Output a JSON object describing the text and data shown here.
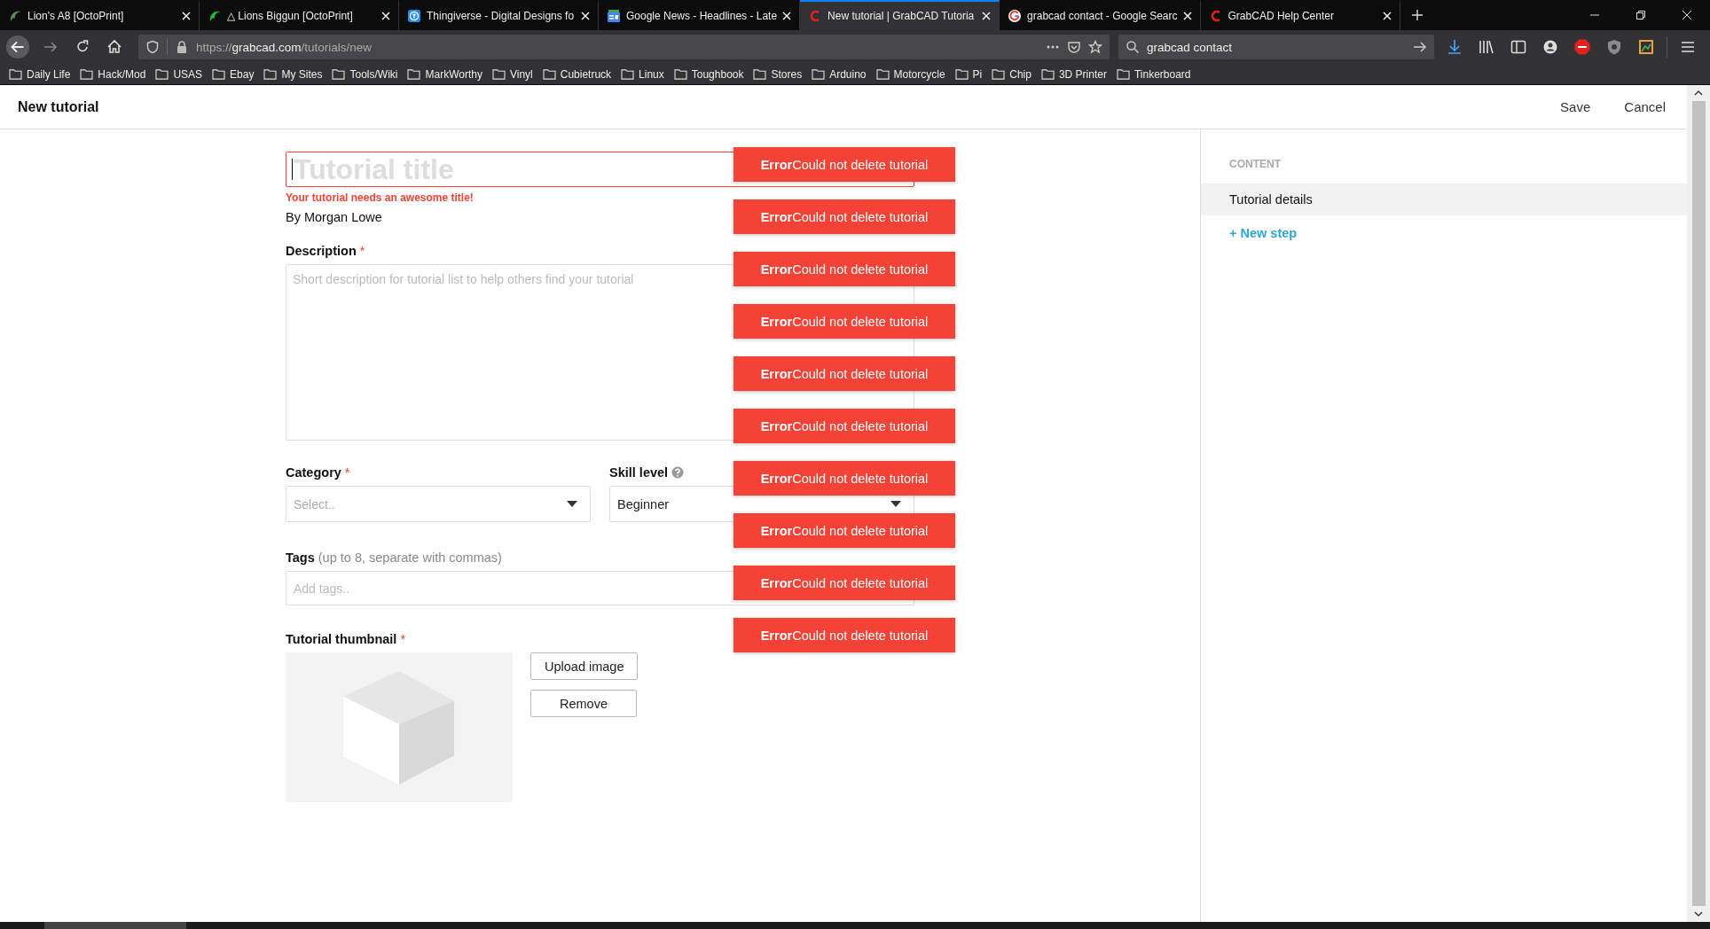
{
  "browser": {
    "tabs": [
      {
        "title": "Lion's A8 [OctoPrint]",
        "kind": "leaf",
        "selected": false
      },
      {
        "title": "△ Lions Biggun [OctoPrint]",
        "kind": "leaf",
        "selected": false
      },
      {
        "title": "Thingiverse - Digital Designs fo",
        "kind": "badge",
        "selected": false
      },
      {
        "title": "Google News - Headlines - Late",
        "kind": "news",
        "selected": false
      },
      {
        "title": "New tutorial | GrabCAD Tutoria",
        "kind": "c",
        "selected": true
      },
      {
        "title": "grabcad contact - Google Searc",
        "kind": "g",
        "selected": false
      },
      {
        "title": "GrabCAD Help Center",
        "kind": "c",
        "selected": false
      }
    ],
    "url": {
      "scheme": "https://",
      "host": "grabcad.com",
      "path": "/tutorials/new"
    },
    "search_value": "grabcad contact",
    "bookmarks": [
      "Daily Life",
      "Hack/Mod",
      "USAS",
      "Ebay",
      "My Sites",
      "Tools/Wiki",
      "MarkWorthy",
      "Vinyl",
      "Cubietruck",
      "Linux",
      "Toughbook",
      "Stores",
      "Arduino",
      "Motorcycle",
      "Pi",
      "Chip",
      "3D Printer",
      "Tinkerboard"
    ]
  },
  "header": {
    "title": "New tutorial",
    "actions": [
      "Save",
      "Cancel"
    ]
  },
  "form": {
    "title_field": {
      "placeholder": "Tutorial title",
      "error": "Your tutorial needs an awesome title!"
    },
    "author": "By Morgan Lowe",
    "description": {
      "label": "Description",
      "required_mark": "*",
      "placeholder": "Short description for tutorial list to help others find your tutorial"
    },
    "category": {
      "label": "Category",
      "required_mark": "*",
      "placeholder": "Select.."
    },
    "skill_level": {
      "label": "Skill level",
      "value": "Beginner"
    },
    "tags": {
      "label": "Tags",
      "hint": "(up to 8, separate with commas)",
      "placeholder": "Add tags.."
    },
    "thumbnail": {
      "label": "Tutorial thumbnail",
      "required_mark": "*",
      "buttons": [
        "Upload image",
        "Remove"
      ]
    }
  },
  "sidebar": {
    "heading": "CONTENT",
    "items": [
      {
        "label": "Tutorial details",
        "selected": true
      }
    ],
    "add_link": "+ New step"
  },
  "toasts": [
    {
      "title": "Error",
      "message": "Could not delete tutorial"
    },
    {
      "title": "Error",
      "message": "Could not delete tutorial"
    },
    {
      "title": "Error",
      "message": "Could not delete tutorial"
    },
    {
      "title": "Error",
      "message": "Could not delete tutorial"
    },
    {
      "title": "Error",
      "message": "Could not delete tutorial"
    },
    {
      "title": "Error",
      "message": "Could not delete tutorial"
    },
    {
      "title": "Error",
      "message": "Could not delete tutorial"
    },
    {
      "title": "Error",
      "message": "Could not delete tutorial"
    },
    {
      "title": "Error",
      "message": "Could not delete tutorial"
    },
    {
      "title": "Error",
      "message": "Could not delete tutorial"
    }
  ]
}
